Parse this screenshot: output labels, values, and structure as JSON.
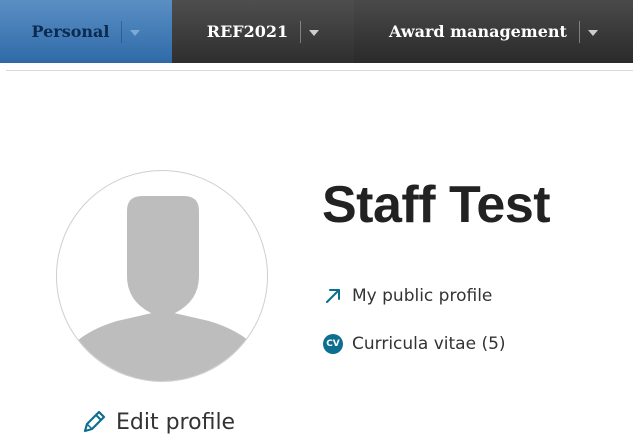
{
  "nav": {
    "tabs": [
      {
        "label": "Personal",
        "active": true
      },
      {
        "label": "REF2021",
        "active": false
      },
      {
        "label": "Award management",
        "active": false
      }
    ]
  },
  "profile": {
    "name": "Staff Test",
    "edit_label": "Edit profile",
    "avatar_icon": "default-user-silhouette-icon"
  },
  "links": {
    "public_profile": {
      "label": "My public profile",
      "icon": "external-arrow-icon"
    },
    "curricula_vitae": {
      "label": "Curricula vitae (5)",
      "icon": "cv-badge-icon",
      "badge_text": "CV"
    }
  },
  "colors": {
    "active_tab": "#2f6aa8",
    "inactive_tab": "#333333",
    "accent": "#0d6f8f"
  }
}
